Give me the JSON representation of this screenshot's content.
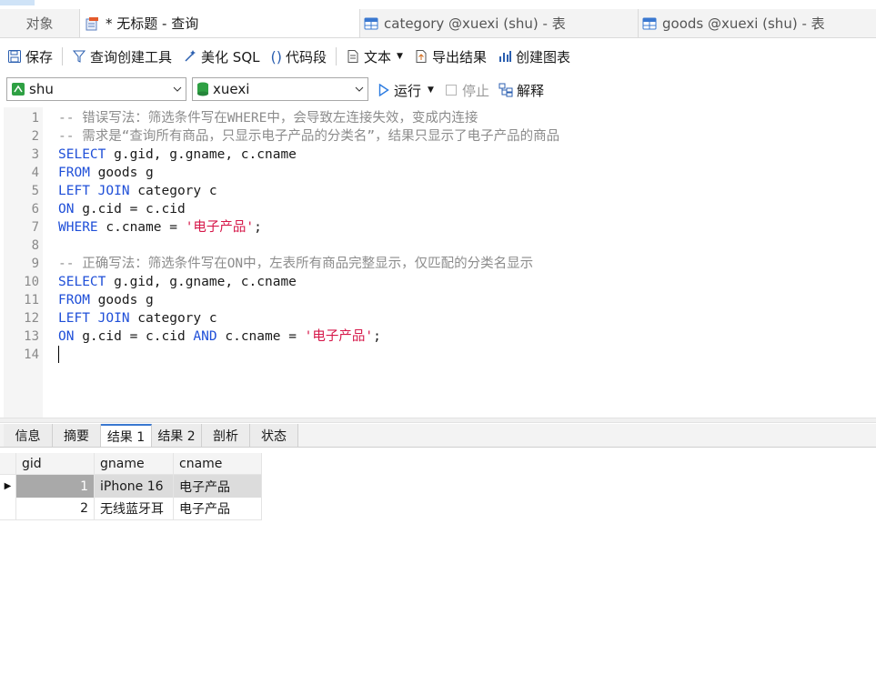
{
  "tabs": [
    {
      "label": "对象",
      "icon": "none"
    },
    {
      "label": "* 无标题 - 查询",
      "icon": "query-icon"
    },
    {
      "label": "category @xuexi (shu) - 表",
      "icon": "table-icon"
    },
    {
      "label": "goods @xuexi (shu) - 表",
      "icon": "table-icon"
    }
  ],
  "toolbar": {
    "save": "保存",
    "query_builder": "查询创建工具",
    "beautify": "美化 SQL",
    "snippet": "代码段",
    "text": "文本",
    "export": "导出结果",
    "chart": "创建图表"
  },
  "connection": {
    "value": "shu"
  },
  "database": {
    "value": "xuexi"
  },
  "actions": {
    "run": "运行",
    "stop": "停止",
    "explain": "解释"
  },
  "editor": {
    "line_numbers": [
      "1",
      "2",
      "3",
      "4",
      "5",
      "6",
      "7",
      "8",
      "9",
      "10",
      "11",
      "12",
      "13",
      "14"
    ],
    "lines": [
      "-- 错误写法：筛选条件写在WHERE中，会导致左连接失效，变成内连接",
      "-- 需求是“查询所有商品，只显示电子产品的分类名”，结果只显示了电子产品的商品",
      "SELECT g.gid, g.gname, c.cname",
      "FROM goods g",
      "LEFT JOIN category c",
      "ON g.cid = c.cid",
      "WHERE c.cname = '电子产品';",
      "",
      "-- 正确写法：筛选条件写在ON中，左表所有商品完整显示，仅匹配的分类名显示",
      "SELECT g.gid, g.gname, c.cname",
      "FROM goods g",
      "LEFT JOIN category c",
      "ON g.cid = c.cid AND c.cname = '电子产品';",
      ""
    ]
  },
  "result_tabs": [
    "信息",
    "摘要",
    "结果 1",
    "结果 2",
    "剖析",
    "状态"
  ],
  "result": {
    "columns": [
      "gid",
      "gname",
      "cname"
    ],
    "rows": [
      [
        "1",
        "iPhone 16",
        "电子产品"
      ],
      [
        "2",
        "无线蓝牙耳",
        "电子产品"
      ]
    ]
  },
  "colors": {
    "keyword": "#1f4fd8",
    "comment": "#8c8c8c",
    "string": "#d6184a",
    "accent": "#3a78d0"
  }
}
